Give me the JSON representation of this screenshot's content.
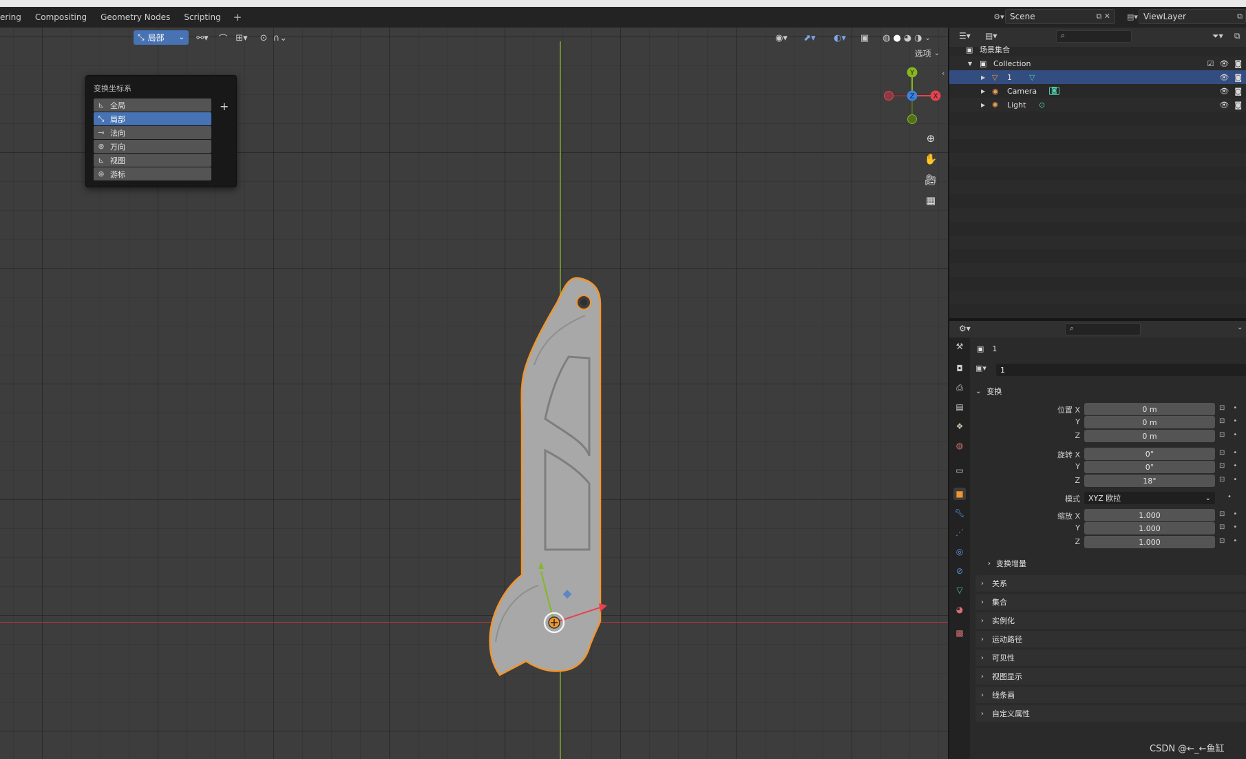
{
  "topbar": {
    "tabs": [
      "ering",
      "Compositing",
      "Geometry Nodes",
      "Scripting"
    ],
    "add": "+",
    "scene": "Scene",
    "view_layer": "ViewLayer"
  },
  "viewport": {
    "orientation_value": "局部",
    "options_label": "选项"
  },
  "orientation_popup": {
    "title": "变换坐标系",
    "items": [
      {
        "label": "全局",
        "icon": "global-axis-icon"
      },
      {
        "label": "局部",
        "icon": "local-axis-icon",
        "selected": true
      },
      {
        "label": "法向",
        "icon": "normal-axis-icon"
      },
      {
        "label": "万向",
        "icon": "gimbal-axis-icon"
      },
      {
        "label": "视图",
        "icon": "view-axis-icon"
      },
      {
        "label": "游标",
        "icon": "cursor-axis-icon"
      }
    ],
    "add": "+"
  },
  "gizmo": {
    "x": "X",
    "y": "Y",
    "z": "Z"
  },
  "outliner": {
    "root": "场景集合",
    "collection": "Collection",
    "objects": [
      {
        "label": "1",
        "icon": "mesh-object-icon",
        "selected": true
      },
      {
        "label": "Camera",
        "icon": "camera-object-icon"
      },
      {
        "label": "Light",
        "icon": "light-object-icon"
      }
    ]
  },
  "properties": {
    "object_name": "1",
    "data_name": "1",
    "transform_title": "变换",
    "location_label": "位置 X",
    "rotation_label": "旋转 X",
    "scale_label": "缩放 X",
    "y_label": "Y",
    "z_label": "Z",
    "location": [
      "0 m",
      "0 m",
      "0 m"
    ],
    "rotation": [
      "0°",
      "0°",
      "18°"
    ],
    "mode_label": "模式",
    "mode_value": "XYZ 欧拉",
    "scale": [
      "1.000",
      "1.000",
      "1.000"
    ],
    "delta_transform": "变换增量",
    "panels": [
      "关系",
      "集合",
      "实例化",
      "运动路径",
      "可见性",
      "视图显示",
      "线条画",
      "自定义属性"
    ]
  },
  "colors": {
    "accent": "#4772b3",
    "selection_outline": "#f0962e",
    "axis_x": "#e8424f",
    "axis_y": "#86b81e",
    "axis_z": "#3b83e0"
  },
  "watermark": "CSDN @←_←鱼缸"
}
